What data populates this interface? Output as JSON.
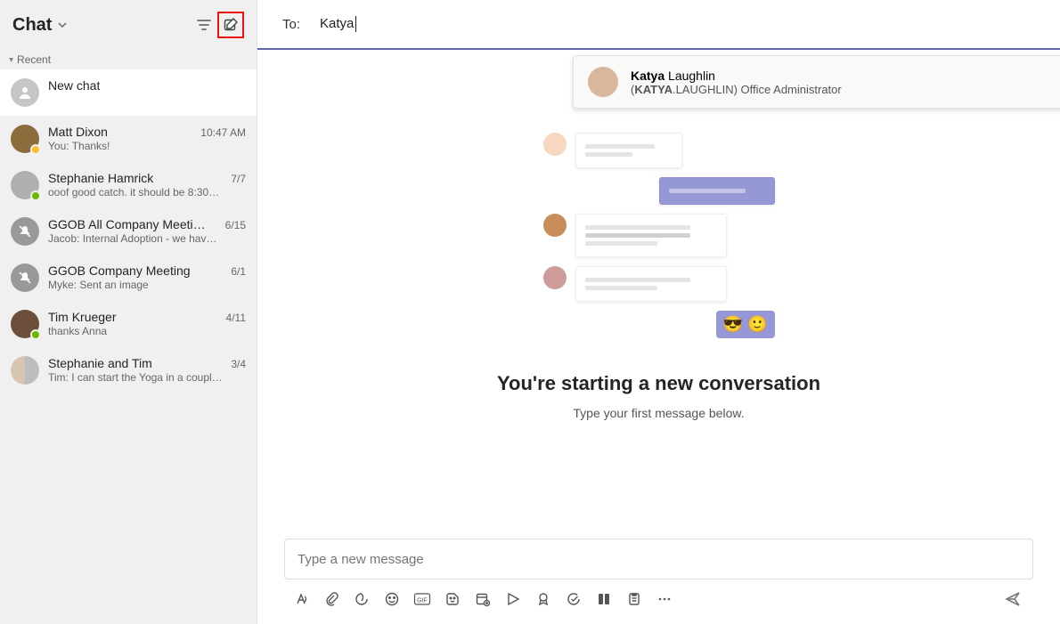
{
  "sidebar": {
    "title": "Chat",
    "recent_label": "Recent",
    "new_chat_label": "New chat",
    "chats": [
      {
        "name": "Matt Dixon",
        "time": "10:47 AM",
        "preview": "You: Thanks!",
        "presence": "away"
      },
      {
        "name": "Stephanie Hamrick",
        "time": "7/7",
        "preview": "ooof good catch. it should be 8:30…",
        "presence": "avail"
      },
      {
        "name": "GGOB All Company Meeti…",
        "time": "6/15",
        "preview": "Jacob: Internal Adoption - we hav…",
        "muted": true
      },
      {
        "name": "GGOB Company Meeting",
        "time": "6/1",
        "preview": "Myke: Sent an image",
        "muted": true
      },
      {
        "name": "Tim Krueger",
        "time": "4/11",
        "preview": "thanks Anna",
        "presence": "avail"
      },
      {
        "name": "Stephanie and Tim",
        "time": "3/4",
        "preview": "Tim: I can start the Yoga in a coupl…",
        "group": true
      }
    ]
  },
  "to": {
    "label": "To:",
    "value": "Katya"
  },
  "suggestion": {
    "name_bold": "Katya",
    "name_rest": " Laughlin",
    "sub_prefix": "(",
    "sub_bold": "KATYA",
    "sub_rest": ".LAUGHLIN) Office Administrator"
  },
  "empty": {
    "title": "You're starting a new conversation",
    "subtitle": "Type your first message below."
  },
  "composer": {
    "placeholder": "Type a new message"
  },
  "icons": {
    "filter": "filter-icon",
    "compose": "compose-icon",
    "format": "format-icon",
    "attach": "attach-icon",
    "loop": "loop-icon",
    "emoji": "emoji-icon",
    "gif": "gif-icon",
    "sticker": "sticker-icon",
    "schedule": "schedule-icon",
    "stream": "stream-icon",
    "approve": "approve-icon",
    "updates": "updates-icon",
    "apps": "apps-icon",
    "poll": "poll-icon",
    "more": "more-icon",
    "send": "send-icon"
  }
}
